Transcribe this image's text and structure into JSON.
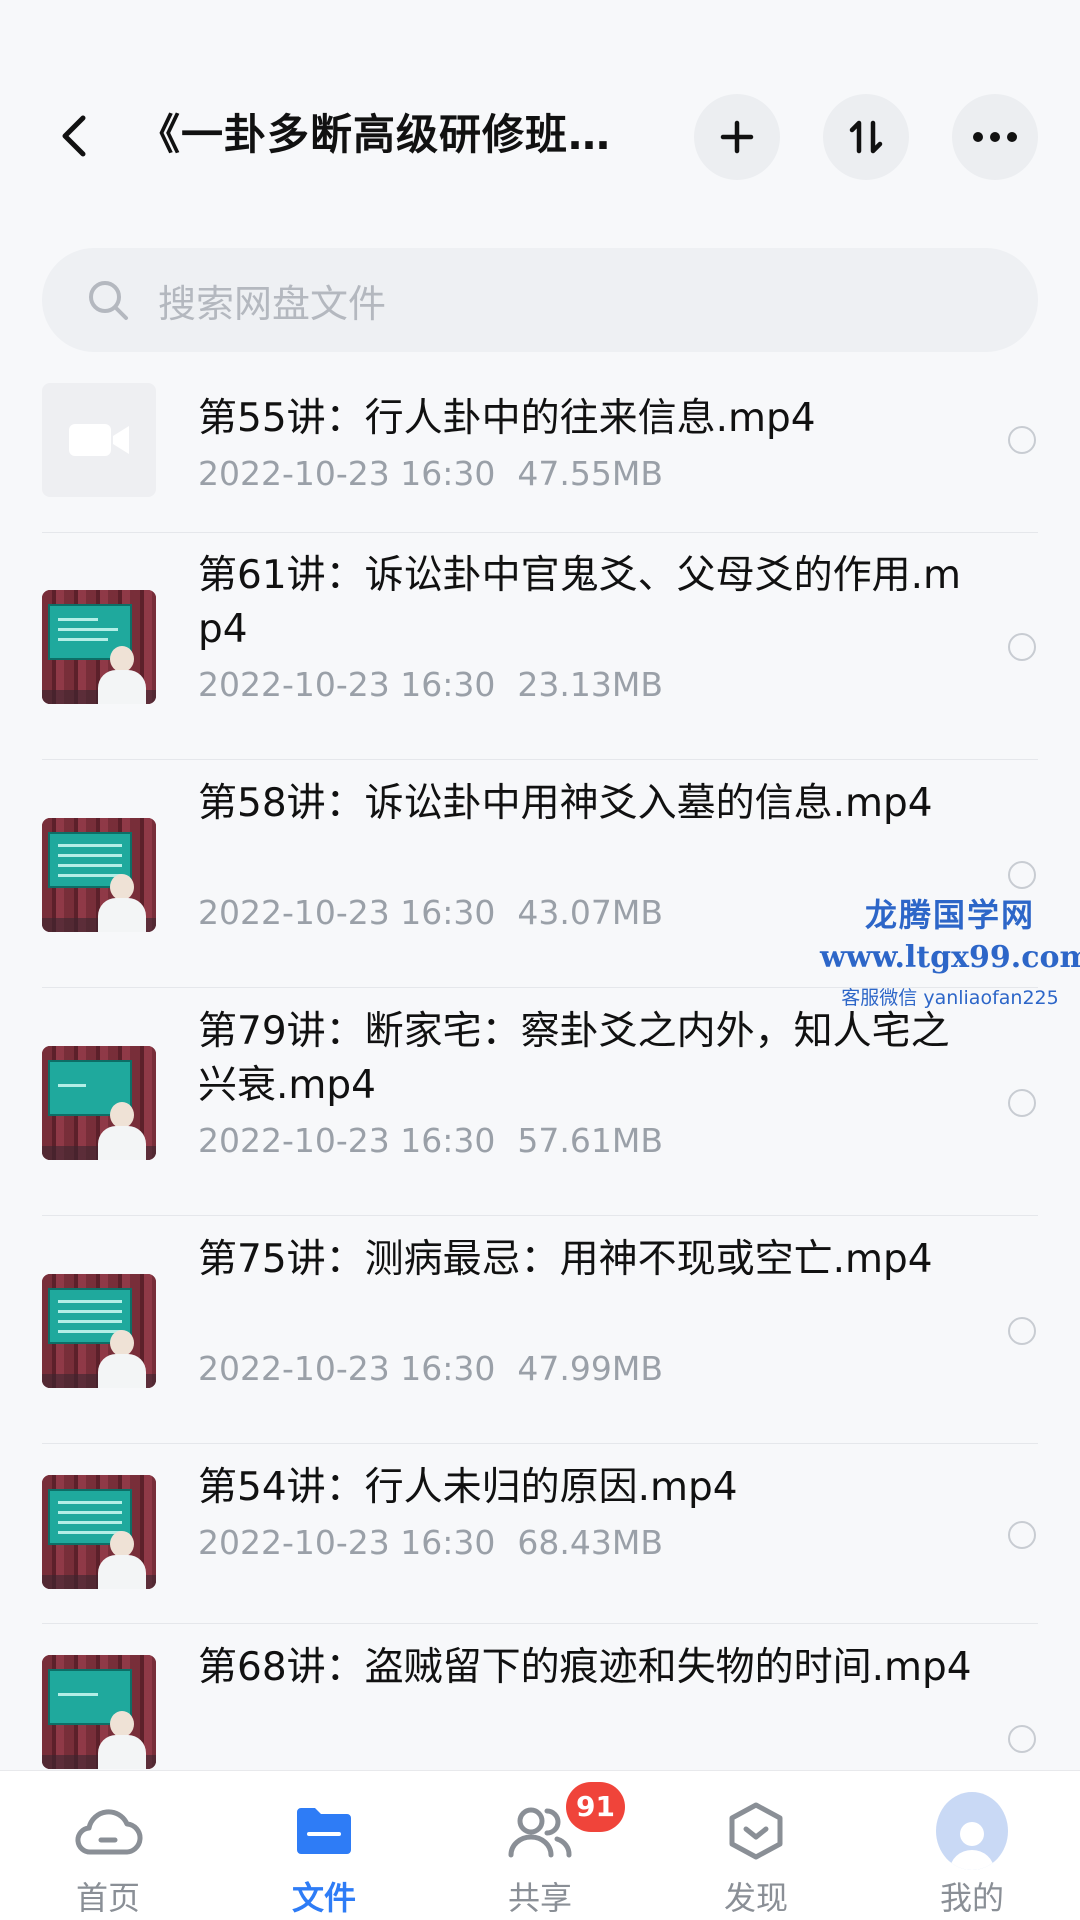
{
  "header": {
    "title": "《一卦多断高级研修班…",
    "back_icon": "chevron-left-icon",
    "add_icon": "plus-icon",
    "sort_icon": "sort-icon",
    "more_icon": "more-icon"
  },
  "search": {
    "placeholder": "搜索网盘文件"
  },
  "files": [
    {
      "name": "第55讲：行人卦中的往来信息.mp4",
      "date": "2022-10-23  16:30",
      "size": "47.55MB",
      "thumb": "placeholder"
    },
    {
      "name": "第61讲：诉讼卦中官鬼爻、父母爻的作用.mp4",
      "date": "2022-10-23  16:30",
      "size": "23.13MB",
      "thumb": "video"
    },
    {
      "name": "第58讲：诉讼卦中用神爻入墓的信息.mp4",
      "date": "2022-10-23  16:30",
      "size": "43.07MB",
      "thumb": "video"
    },
    {
      "name": "第79讲：断家宅：察卦爻之内外，知人宅之兴衰.mp4",
      "date": "2022-10-23  16:30",
      "size": "57.61MB",
      "thumb": "video"
    },
    {
      "name": "第75讲：测病最忌：用神不现或空亡.mp4",
      "date": "2022-10-23  16:30",
      "size": "47.99MB",
      "thumb": "video"
    },
    {
      "name": "第54讲：行人未归的原因.mp4",
      "date": "2022-10-23  16:30",
      "size": "68.43MB",
      "thumb": "video"
    },
    {
      "name": "第68讲：盗贼留下的痕迹和失物的时间.mp4",
      "date": "",
      "size": "",
      "thumb": "video"
    }
  ],
  "watermark": {
    "line1": "龙腾国学网",
    "line2": "www.ltgx99.com",
    "line3": "客服微信 yanliaofan225"
  },
  "tabbar": {
    "tabs": [
      {
        "label": "首页",
        "icon": "cloud-icon"
      },
      {
        "label": "文件",
        "icon": "folder-icon"
      },
      {
        "label": "共享",
        "icon": "people-icon"
      },
      {
        "label": "发现",
        "icon": "discover-icon"
      },
      {
        "label": "我的",
        "icon": "avatar-icon"
      }
    ],
    "active": "文件",
    "share_badge": "91"
  },
  "colors": {
    "accent": "#2e7cf6",
    "badge": "#f0443a",
    "watermark": "#2d66c8"
  }
}
